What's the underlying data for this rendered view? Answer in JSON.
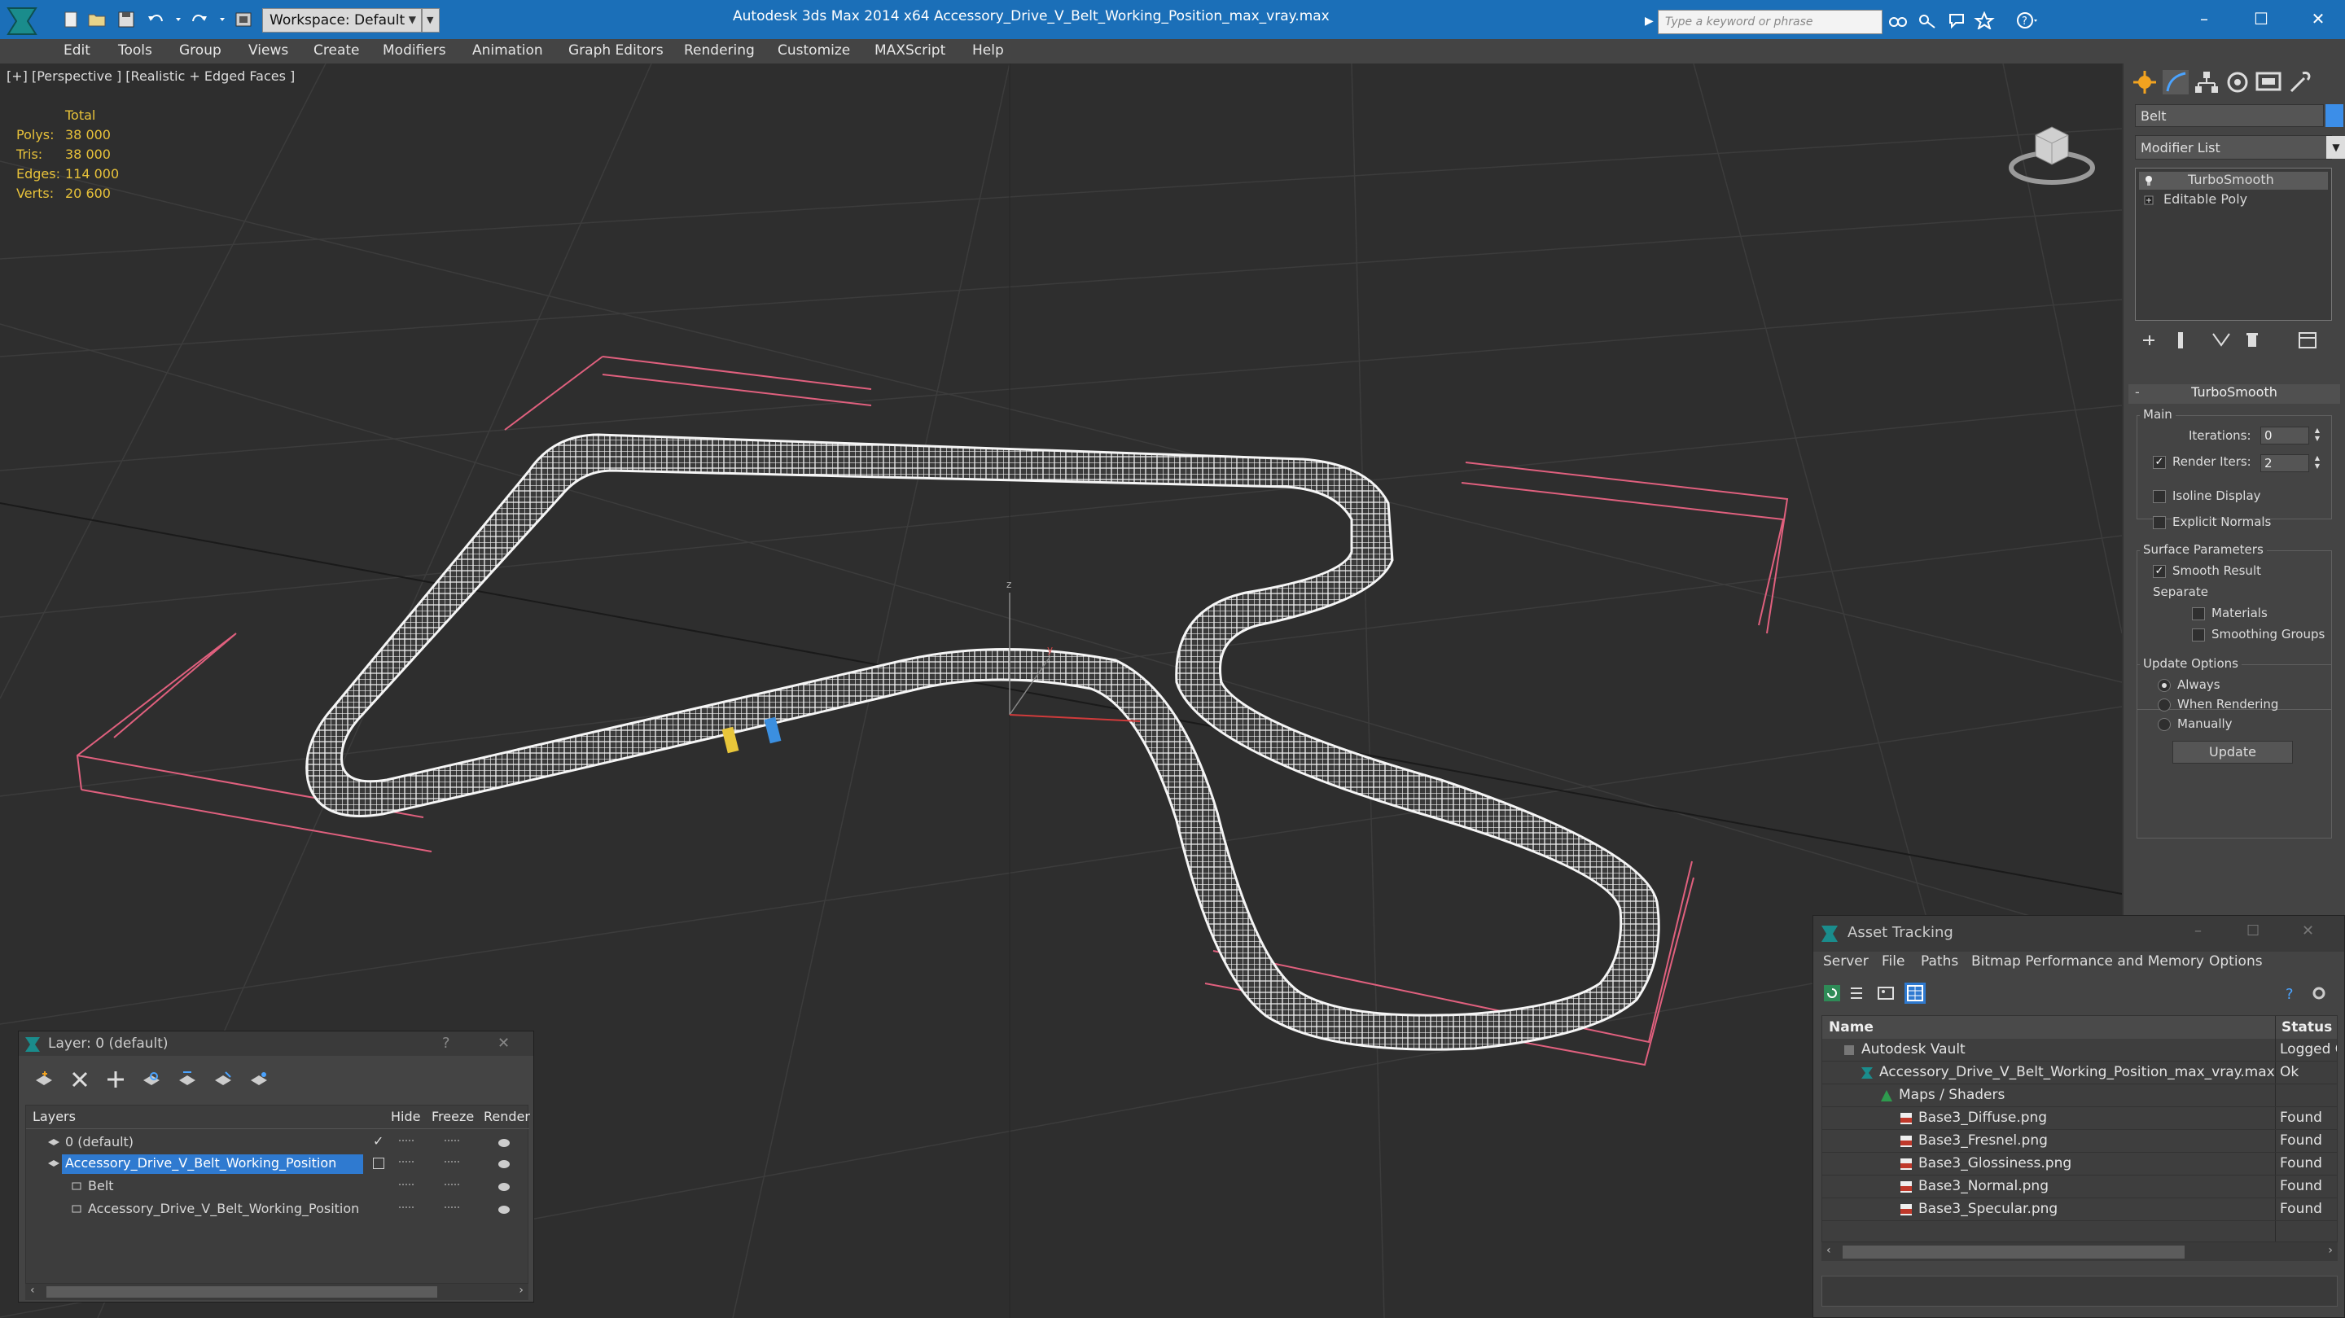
{
  "titlebar": {
    "workspace_label": "Workspace: Default",
    "app_title": "Autodesk 3ds Max  2014 x64      Accessory_Drive_V_Belt_Working_Position_max_vray.max",
    "search_placeholder": "Type a keyword or phrase"
  },
  "menu": [
    "Edit",
    "Tools",
    "Group",
    "Views",
    "Create",
    "Modifiers",
    "Animation",
    "Graph Editors",
    "Rendering",
    "Customize",
    "MAXScript",
    "Help"
  ],
  "viewport": {
    "label": "[+] [Perspective ] [Realistic + Edged Faces ]",
    "stats": {
      "total_label": "Total",
      "rows": [
        {
          "key": "Polys:",
          "value": "38 000"
        },
        {
          "key": "Tris:",
          "value": "38 000"
        },
        {
          "key": "Edges:",
          "value": "114 000"
        },
        {
          "key": "Verts:",
          "value": "20 600"
        }
      ]
    }
  },
  "command_panel": {
    "object_name": "Belt",
    "object_color": "#3c8ee8",
    "modifier_list": "Modifier List",
    "stack": [
      "TurboSmooth",
      "Editable Poly"
    ],
    "turbosmooth": {
      "title": "TurboSmooth",
      "main_label": "Main",
      "iterations_label": "Iterations:",
      "iterations_value": "0",
      "render_iters_label": "Render Iters:",
      "render_iters_value": "2",
      "render_iters_checked": true,
      "isoline_label": "Isoline Display",
      "isoline_checked": false,
      "explicit_normals_label": "Explicit Normals",
      "explicit_normals_checked": false,
      "surface_label": "Surface Parameters",
      "smooth_result_label": "Smooth Result",
      "smooth_result_checked": true,
      "separate_label": "Separate",
      "materials_label": "Materials",
      "smoothing_groups_label": "Smoothing Groups",
      "update_options_label": "Update Options",
      "always_label": "Always",
      "when_rendering_label": "When Rendering",
      "manually_label": "Manually",
      "update_option_selected": "Always",
      "update_button": "Update"
    }
  },
  "layer_dialog": {
    "title": "Layer: 0 (default)",
    "columns": [
      "Layers",
      "Hide",
      "Freeze",
      "Render"
    ],
    "rows": [
      {
        "name": "0 (default)",
        "selected": false
      },
      {
        "name": "Accessory_Drive_V_Belt_Working_Position",
        "selected": true
      },
      {
        "name": "Belt",
        "selected": false
      },
      {
        "name": "Accessory_Drive_V_Belt_Working_Position",
        "selected": false
      }
    ]
  },
  "asset_tracking": {
    "title": "Asset Tracking",
    "menu": [
      "Server",
      "File",
      "Paths",
      "Bitmap Performance and Memory",
      "Options"
    ],
    "columns": [
      "Name",
      "Status"
    ],
    "rows": [
      {
        "name": "Autodesk Vault",
        "status": "Logged O",
        "icon": "vault-icon"
      },
      {
        "name": "Accessory_Drive_V_Belt_Working_Position_max_vray.max",
        "status": "Ok",
        "icon": "max-file-icon"
      },
      {
        "name": "Maps / Shaders",
        "status": "",
        "icon": "maps-icon"
      },
      {
        "name": "Base3_Diffuse.png",
        "status": "Found",
        "icon": "png-icon"
      },
      {
        "name": "Base3_Fresnel.png",
        "status": "Found",
        "icon": "png-icon"
      },
      {
        "name": "Base3_Glossiness.png",
        "status": "Found",
        "icon": "png-icon"
      },
      {
        "name": "Base3_Normal.png",
        "status": "Found",
        "icon": "png-icon"
      },
      {
        "name": "Base3_Specular.png",
        "status": "Found",
        "icon": "png-icon"
      }
    ]
  }
}
